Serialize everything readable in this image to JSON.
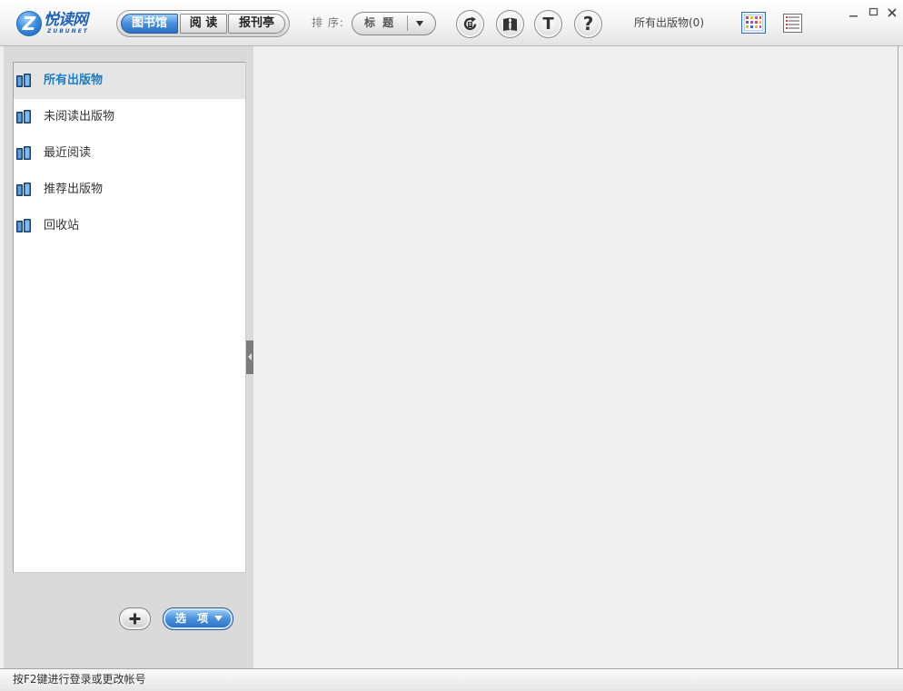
{
  "logo": {
    "letter": "Z",
    "name": "悦读网",
    "subtitle": "ZUBUNET"
  },
  "nav_tabs": [
    {
      "label": "图书馆",
      "selected": true
    },
    {
      "label": "阅 读",
      "selected": false
    },
    {
      "label": "报刊亭",
      "selected": false
    }
  ],
  "sort": {
    "label": "排 序:",
    "selected": "标 题"
  },
  "toolbar": {
    "buttons": [
      {
        "icon": "refresh-icon"
      },
      {
        "icon": "book-info-icon"
      },
      {
        "icon": "font-icon",
        "glyph": "T"
      },
      {
        "icon": "help-icon",
        "glyph": "?"
      }
    ]
  },
  "collection_title": "所有出版物(0)",
  "view_modes": [
    {
      "icon": "grid-view-icon",
      "selected": true
    },
    {
      "icon": "list-view-icon",
      "selected": false
    }
  ],
  "window_controls": [
    "minimize-icon",
    "maximize-icon",
    "close-icon"
  ],
  "sidebar": {
    "items": [
      {
        "label": "所有出版物",
        "icon": "book-icon",
        "selected": true
      },
      {
        "label": "未阅读出版物",
        "icon": "book-icon",
        "selected": false
      },
      {
        "label": "最近阅读",
        "icon": "book-icon",
        "selected": false
      },
      {
        "label": "推荐出版物",
        "icon": "book-icon",
        "selected": false
      },
      {
        "label": "回收站",
        "icon": "book-icon",
        "selected": false
      }
    ],
    "add_icon": "plus-icon",
    "options_label": "选 项"
  },
  "status_bar": {
    "text": "按F2键进行登录或更改帐号"
  },
  "colors": {
    "accent": "#2f78c8",
    "selected_item_text": "#1a7fc4",
    "panel_bg": "#dadada",
    "content_bg": "#f0f0f0"
  }
}
